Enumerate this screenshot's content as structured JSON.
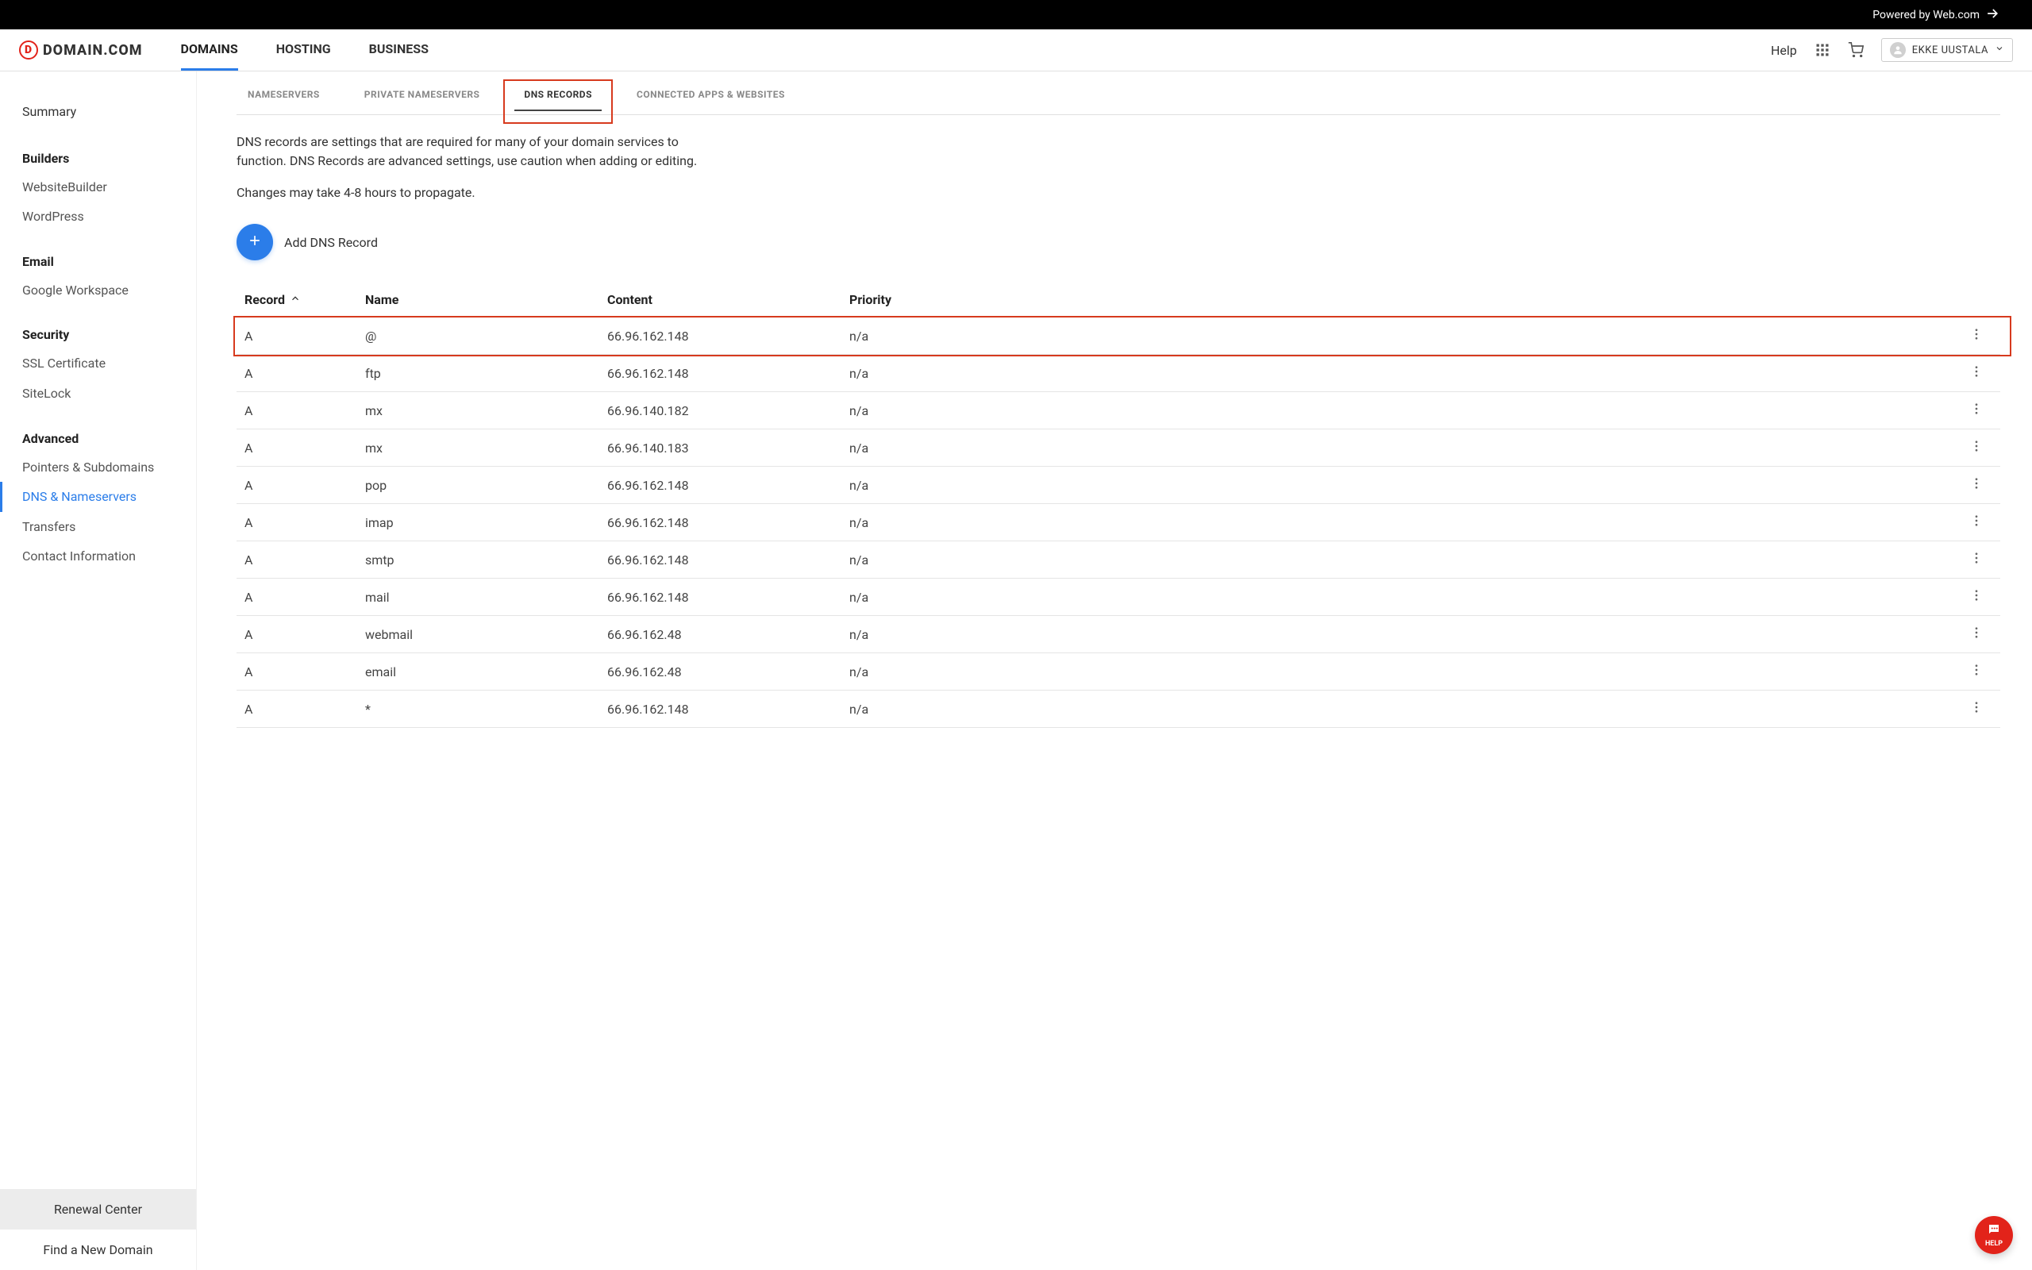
{
  "topbar": {
    "powered_by": "Powered by Web.com"
  },
  "logo": {
    "text": "DOMAIN.COM"
  },
  "nav": {
    "domains": "DOMAINS",
    "hosting": "HOSTING",
    "business": "BUSINESS"
  },
  "header": {
    "help": "Help",
    "user_name": "EKKE UUSTALA"
  },
  "sidebar": {
    "summary": "Summary",
    "builders_title": "Builders",
    "builders": {
      "website_builder": "WebsiteBuilder",
      "wordpress": "WordPress"
    },
    "email_title": "Email",
    "email": {
      "google_workspace": "Google Workspace"
    },
    "security_title": "Security",
    "security": {
      "ssl": "SSL Certificate",
      "sitelock": "SiteLock"
    },
    "advanced_title": "Advanced",
    "advanced": {
      "pointers": "Pointers & Subdomains",
      "dns": "DNS & Nameservers",
      "transfers": "Transfers",
      "contact": "Contact Information"
    },
    "bottom": {
      "renewal": "Renewal Center",
      "find": "Find a New Domain"
    }
  },
  "subtabs": {
    "nameservers": "NAMESERVERS",
    "private_ns": "PRIVATE NAMESERVERS",
    "dns_records": "DNS RECORDS",
    "connected": "CONNECTED APPS & WEBSITES"
  },
  "description": "DNS records are settings that are required for many of your domain services to function. DNS Records are advanced settings, use caution when adding or editing.",
  "propagation": "Changes may take 4-8 hours to propagate.",
  "add_record_label": "Add DNS Record",
  "table_headers": {
    "record": "Record",
    "name": "Name",
    "content": "Content",
    "priority": "Priority"
  },
  "records": [
    {
      "type": "A",
      "name": "@",
      "content": "66.96.162.148",
      "priority": "n/a"
    },
    {
      "type": "A",
      "name": "ftp",
      "content": "66.96.162.148",
      "priority": "n/a"
    },
    {
      "type": "A",
      "name": "mx",
      "content": "66.96.140.182",
      "priority": "n/a"
    },
    {
      "type": "A",
      "name": "mx",
      "content": "66.96.140.183",
      "priority": "n/a"
    },
    {
      "type": "A",
      "name": "pop",
      "content": "66.96.162.148",
      "priority": "n/a"
    },
    {
      "type": "A",
      "name": "imap",
      "content": "66.96.162.148",
      "priority": "n/a"
    },
    {
      "type": "A",
      "name": "smtp",
      "content": "66.96.162.148",
      "priority": "n/a"
    },
    {
      "type": "A",
      "name": "mail",
      "content": "66.96.162.148",
      "priority": "n/a"
    },
    {
      "type": "A",
      "name": "webmail",
      "content": "66.96.162.48",
      "priority": "n/a"
    },
    {
      "type": "A",
      "name": "email",
      "content": "66.96.162.48",
      "priority": "n/a"
    },
    {
      "type": "A",
      "name": "*",
      "content": "66.96.162.148",
      "priority": "n/a"
    }
  ],
  "help_bubble": "HELP",
  "colors": {
    "accent_blue": "#2b7de9",
    "accent_red": "#e2231a",
    "highlight": "#d73a1e"
  }
}
